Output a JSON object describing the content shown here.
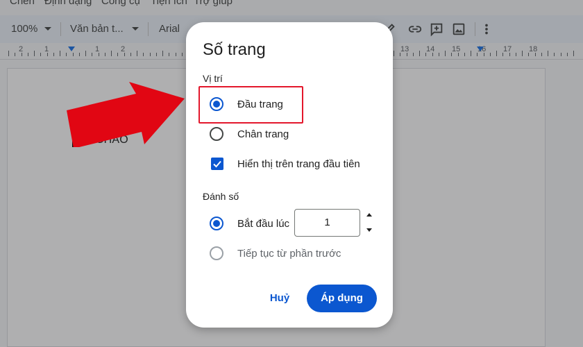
{
  "menu": {
    "items": [
      "Chèn",
      "Định dạng",
      "Công cụ",
      "Tiện ích",
      "Trợ giúp"
    ]
  },
  "toolbar": {
    "zoom": "100%",
    "style": "Văn bản t...",
    "font": "Arial",
    "icons": [
      "pen-icon",
      "link-icon",
      "add-comment-icon",
      "image-icon",
      "more-vert-icon"
    ]
  },
  "ruler": {
    "left_numbers": [
      "2",
      "1",
      "1",
      "2"
    ],
    "right_numbers": [
      "13",
      "14",
      "15",
      "16",
      "17",
      "18"
    ]
  },
  "document": {
    "text": "XIN CHÀO"
  },
  "dialog": {
    "title": "Số trang",
    "position_section": "Vị trí",
    "header_option": "Đầu trang",
    "footer_option": "Chân trang",
    "show_first_page": "Hiển thị trên trang đầu tiên",
    "numbering_section": "Đánh số",
    "start_at": "Bắt đầu lúc",
    "start_value": "1",
    "continue_option": "Tiếp tục từ phần trước",
    "cancel": "Huỷ",
    "apply": "Áp dụng"
  },
  "state": {
    "position": "header",
    "show_on_first_page": true,
    "numbering": "start_at"
  },
  "colors": {
    "accent": "#0b57d0",
    "highlight": "#e3162b",
    "arrow": "#e10613"
  }
}
